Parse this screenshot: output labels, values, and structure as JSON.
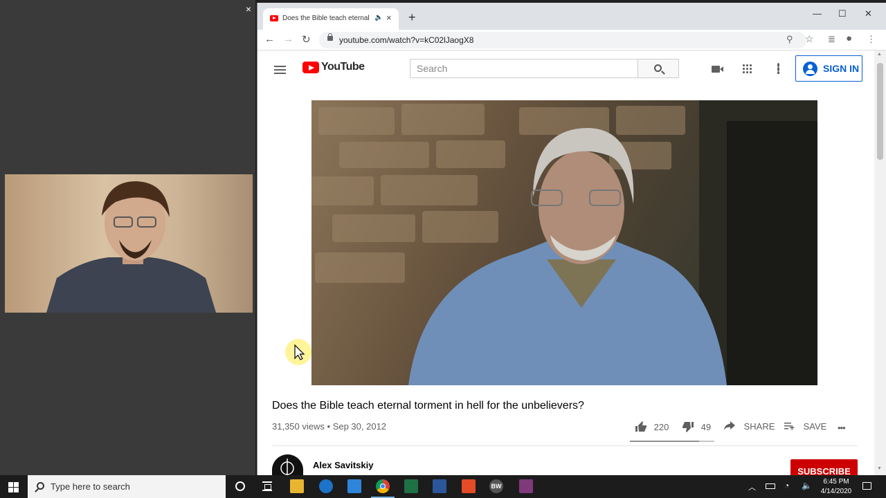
{
  "left_panel": {
    "close_glyph": "×"
  },
  "browser": {
    "tab": {
      "title": "Does the Bible teach eternal",
      "audio_glyph": "🔈",
      "close_glyph": "×"
    },
    "new_tab_glyph": "+",
    "window": {
      "minimize": "—",
      "maximize": "☐",
      "close": "✕"
    },
    "nav": {
      "back": "←",
      "forward": "→",
      "reload": "↻"
    },
    "url": "youtube.com/watch?v=kC02lJaogX8",
    "toolbar_icons": {
      "zoom": "⚲",
      "bookmark": "☆",
      "media": "≣",
      "profile": "●",
      "menu": "⋮"
    }
  },
  "youtube": {
    "logo_text": "YouTube",
    "search": {
      "placeholder": "Search"
    },
    "signin_label": "SIGN IN",
    "video": {
      "title": "Does the Bible teach eternal torment in hell for the unbelievers?",
      "views": "31,350 views",
      "date": "Sep 30, 2012",
      "likes": "220",
      "dislikes": "49",
      "like_ratio": 0.82,
      "share_label": "SHARE",
      "save_label": "SAVE",
      "more_glyph": "•••"
    },
    "channel": {
      "name": "Alex Savitskiy"
    },
    "subscribe_label": "SUBSCRIBE",
    "colors": {
      "brand_red": "#ff0000",
      "link_blue": "#065fd4",
      "subscribe_red": "#cc0000"
    }
  },
  "taskbar": {
    "search_text": "Type here to search",
    "apps": [
      "file-explorer",
      "edge",
      "mail",
      "chrome",
      "excel",
      "word",
      "acrobat",
      "bw",
      "onenote"
    ],
    "bw_label": "BW",
    "clock_time": "6:45 PM",
    "clock_date": "4/14/2020"
  }
}
